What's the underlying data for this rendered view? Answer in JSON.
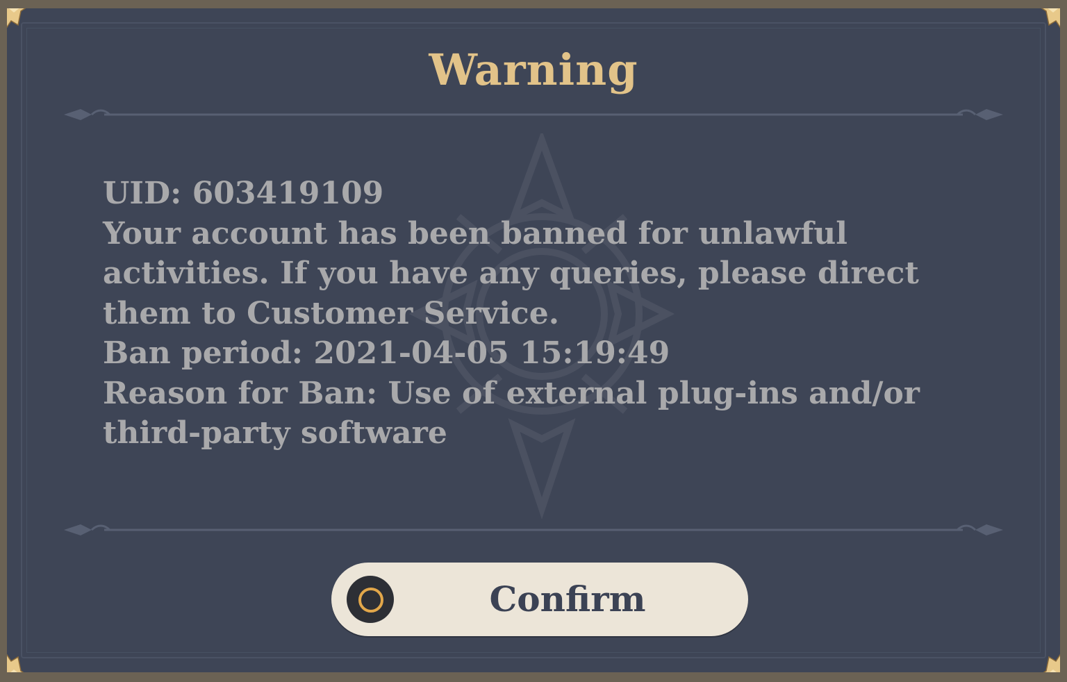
{
  "dialog": {
    "title": "Warning",
    "message_lines": [
      "UID: 603419109",
      "Your account has been banned for unlawful",
      "activities. If you have any queries, please direct",
      "them to Customer Service.",
      "Ban period: 2021-04-05 15:19:49",
      "Reason for Ban: Use of external plug-ins and/or",
      "third-party software"
    ],
    "confirm_label": "Confirm",
    "confirm_icon": "circle-button-icon"
  },
  "colors": {
    "panel_bg": "#3e4556",
    "title": "#e2c389",
    "body_text": "#a9a9ab",
    "button_bg": "#ece5d8",
    "button_text": "#3b4254",
    "icon_ring": "#e2a74a",
    "frame": "#6b6254",
    "corner_ornament": "#e8c98a"
  }
}
